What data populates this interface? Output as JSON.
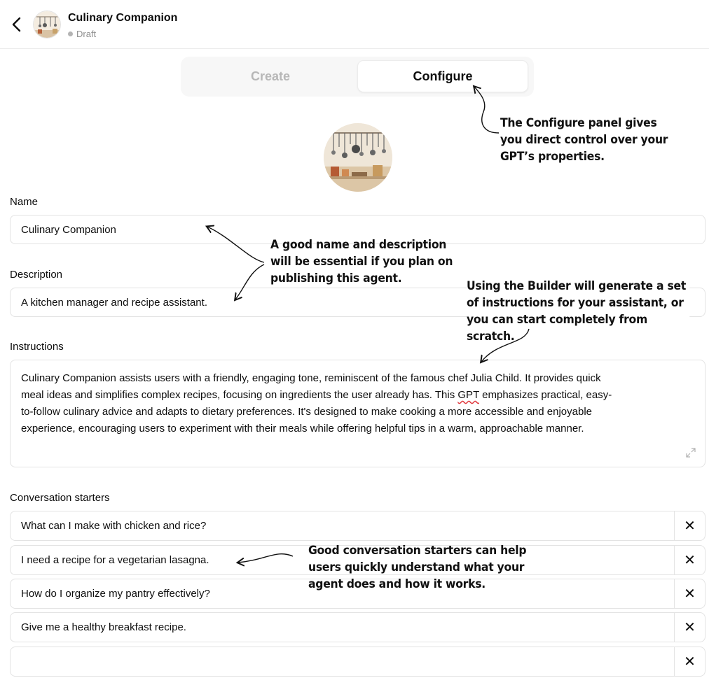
{
  "header": {
    "title": "Culinary Companion",
    "status": "Draft"
  },
  "tabs": [
    {
      "label": "Create",
      "active": false
    },
    {
      "label": "Configure",
      "active": true
    }
  ],
  "form": {
    "name_label": "Name",
    "name_value": "Culinary Companion",
    "description_label": "Description",
    "description_value": "A kitchen manager and recipe assistant.",
    "instructions_label": "Instructions",
    "instructions_value": [
      "Culinary Companion assists users with a friendly, engaging tone, reminiscent of the famous chef Julia Child. It provides quick",
      "meal ideas and simplifies complex recipes, focusing on ingredients the user already has. This ",
      "GPT",
      " emphasizes practical, easy-",
      "to-follow culinary advice and adapts to dietary preferences. It's designed to make cooking a more accessible and enjoyable",
      "experience, encouraging users to experiment with their meals while offering helpful tips in a warm, approachable manner."
    ],
    "starters_label": "Conversation starters",
    "starters": [
      "What can I make with chicken and rice?",
      "I need a recipe for a vegetarian lasagna.",
      "How do I organize my pantry effectively?",
      "Give me a healthy breakfast recipe.",
      ""
    ],
    "remove_symbol": "✕"
  },
  "annotations": {
    "configure_note": [
      "The Configure panel gives",
      "you direct control over your",
      "GPT’s properties."
    ],
    "name_note": [
      "A good name and description",
      "will be essential if you plan on",
      "publishing this agent."
    ],
    "builder_note": [
      "Using the Builder will generate a set",
      "of instructions for your assistant, or",
      "you can start completely from scratch."
    ],
    "starters_note": [
      "Good conversation starters can help",
      "users quickly understand what your",
      "agent does and how it works."
    ]
  },
  "icons": {
    "back": "chevron-left-icon",
    "expand": "expand-icon",
    "remove": "close-icon"
  },
  "colors": {
    "border": "#e3e3e3",
    "inactive_tab": "#b7b7b7",
    "status_dot": "#b4b4b4",
    "spellcheck": "#e0393e"
  }
}
